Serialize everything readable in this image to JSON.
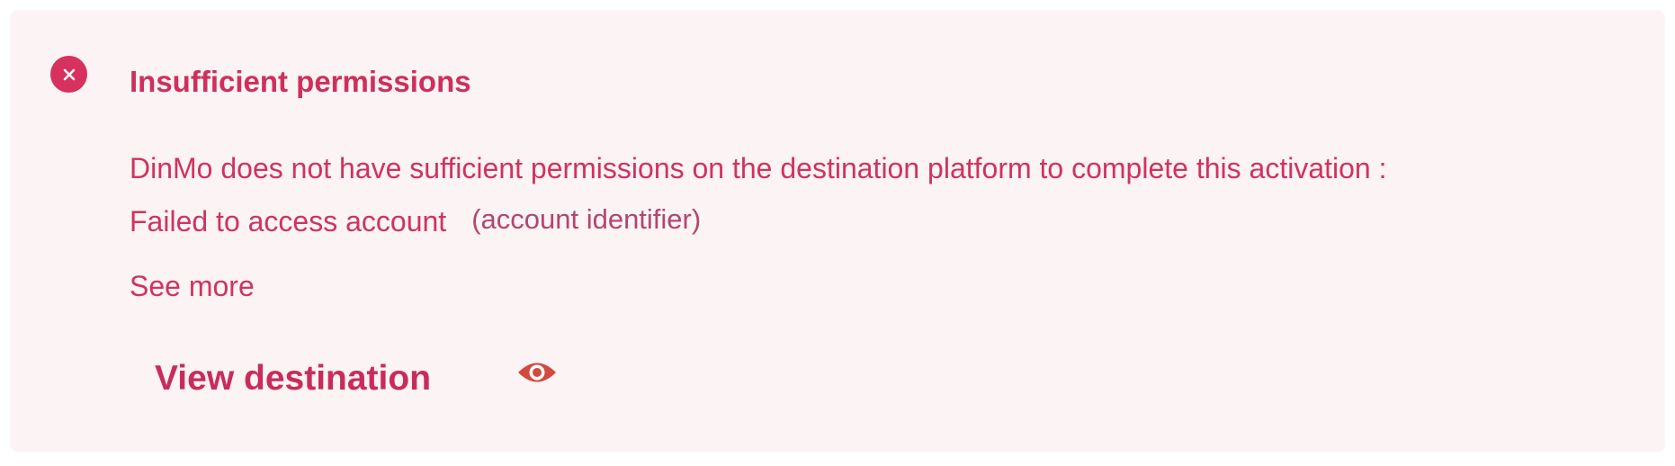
{
  "alert": {
    "title": "Insufficient permissions",
    "message_line_1": "DinMo does not have sufficient permissions on the destination platform to complete this activation :",
    "message_line_2": "Failed to access account",
    "account_identifier": "(account identifier)",
    "see_more": "See more",
    "view_destination": "View destination",
    "icons": {
      "status": "error-x-icon",
      "action": "eye-icon"
    },
    "colors": {
      "accent": "#cf2f5c",
      "background": "#fbf3f4",
      "eye": "#d24a3e"
    }
  }
}
